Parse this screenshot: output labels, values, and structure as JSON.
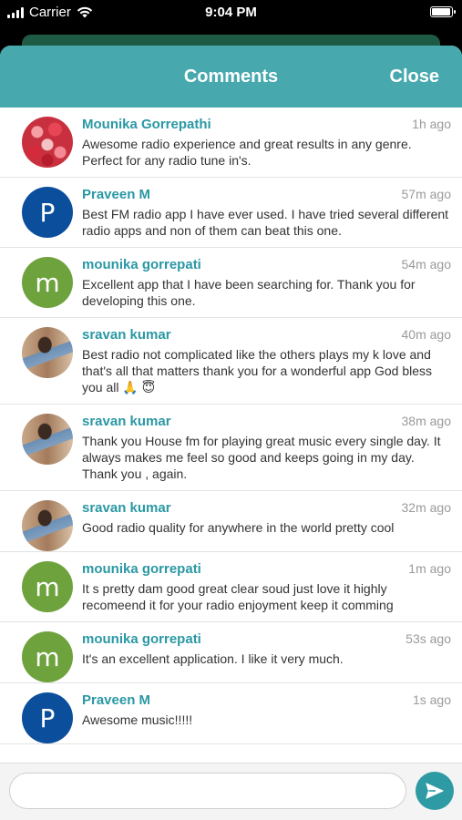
{
  "status_bar": {
    "carrier": "Carrier",
    "time": "9:04 PM",
    "battery_level": 0.95,
    "icons": [
      "signal-icon",
      "wifi-icon",
      "battery-icon"
    ]
  },
  "sheet": {
    "title": "Comments",
    "close_label": "Close",
    "header_color": "#47a9ad"
  },
  "comments": [
    {
      "author": "Mounika Gorrepathi",
      "time": "1h ago",
      "text": "Awesome radio experience and great results in any genre. Perfect for any radio tune in's.",
      "avatar": "flowers",
      "initial": ""
    },
    {
      "author": "Praveen M",
      "time": "57m ago",
      "text": "Best FM radio app I have ever used. I have tried several different radio apps and non of them can beat this one.",
      "avatar": "blue",
      "initial": "P"
    },
    {
      "author": "mounika gorrepati",
      "time": "54m ago",
      "text": "Excellent app that I have been searching for. Thank you for developing this one.",
      "avatar": "green",
      "initial": "m"
    },
    {
      "author": "sravan kumar",
      "time": "40m ago",
      "text": "Best radio not complicated like the others plays my k love and that's all that matters thank you for a wonderful app God bless you all 🙏 😇",
      "avatar": "photo",
      "initial": ""
    },
    {
      "author": "sravan kumar",
      "time": "38m ago",
      "text": "Thank you House fm for playing great music every single day. It always makes me feel so good and keeps going in my day. Thank you , again.",
      "avatar": "photo",
      "initial": ""
    },
    {
      "author": "sravan kumar",
      "time": "32m ago",
      "text": "Good radio quality for anywhere in the world pretty cool",
      "avatar": "photo",
      "initial": ""
    },
    {
      "author": "mounika gorrepati",
      "time": "1m ago",
      "text": "It s pretty dam good great clear soud just love it highly recomeend it for your radio enjoyment keep it comming",
      "avatar": "green",
      "initial": "m"
    },
    {
      "author": "mounika gorrepati",
      "time": "53s ago",
      "text": "It's an excellent application. I like it very much.",
      "avatar": "green",
      "initial": "m"
    },
    {
      "author": "Praveen M",
      "time": "1s ago",
      "text": "Awesome music!!!!!",
      "avatar": "blue",
      "initial": "P"
    }
  ],
  "composer": {
    "value": "",
    "placeholder": "",
    "send_icon": "send-icon",
    "send_color": "#2e9aa4"
  }
}
